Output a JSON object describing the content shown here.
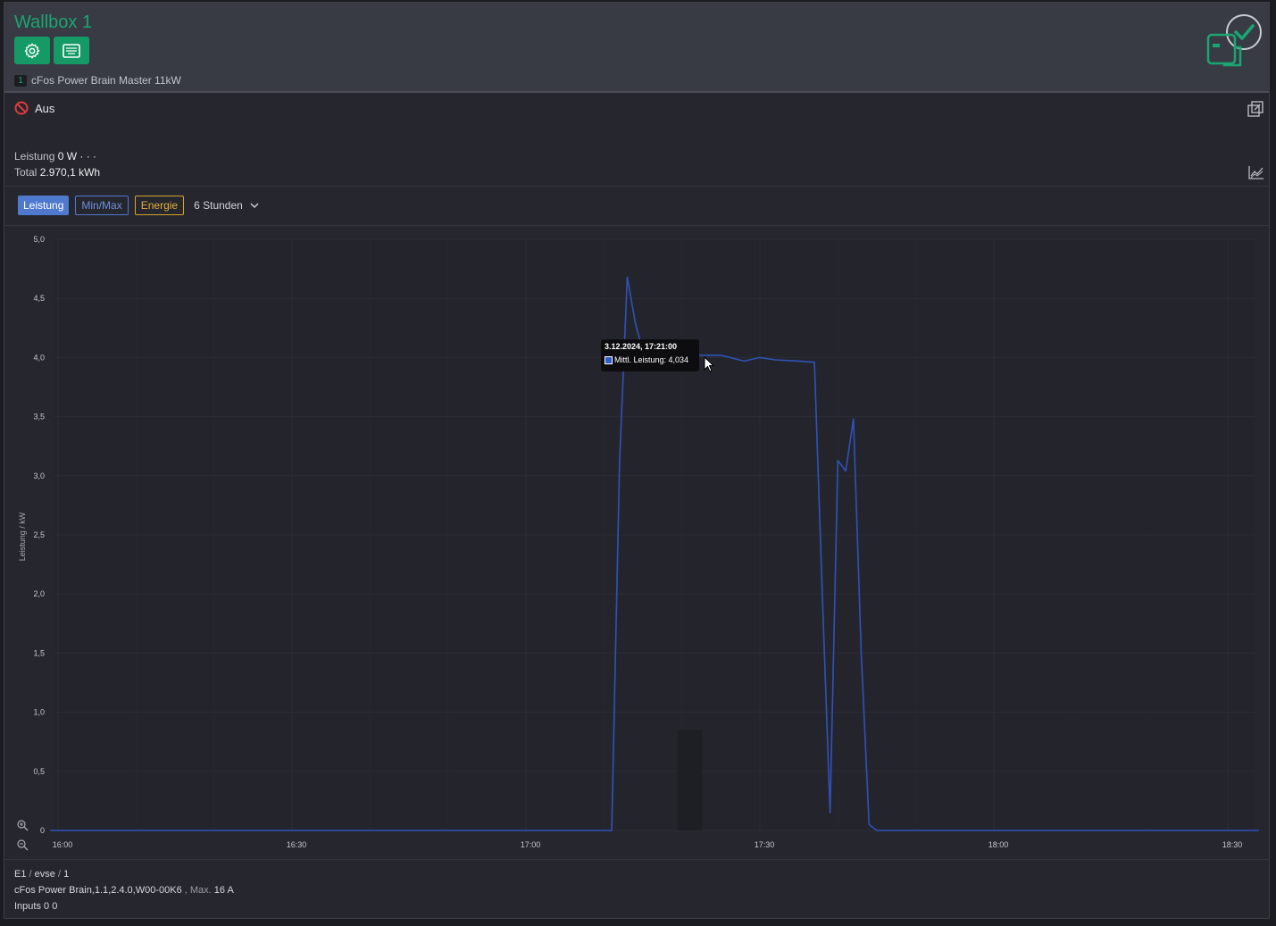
{
  "header": {
    "title": "Wallbox 1",
    "device_number": "1",
    "device_name": "cFos Power Brain Master 11kW"
  },
  "status": {
    "label": "Aus"
  },
  "info": {
    "leistung_label": "Leistung",
    "leistung_value": "0 W · · ·",
    "total_label": "Total",
    "total_value": "2.970,1 kWh"
  },
  "tabs": {
    "leistung": "Leistung",
    "minmax": "Min/Max",
    "energie": "Energie",
    "range": "6 Stunden"
  },
  "tooltip": {
    "date": "3.12.2024, 17:21:00",
    "label": "Mittl. Leistung: 4,034"
  },
  "chart_data": {
    "type": "line",
    "xlabel": "",
    "ylabel": "Leistung / kW",
    "ylim": [
      0,
      5
    ],
    "yticks": [
      "5,0",
      "4,5",
      "4,0",
      "3,5",
      "3,0",
      "2,5",
      "2,0",
      "1,5",
      "1,0",
      "0,5",
      "0"
    ],
    "xticks": [
      "16:00",
      "16:30",
      "17:00",
      "17:30",
      "18:00",
      "18:30"
    ],
    "grid": true,
    "series": [
      {
        "color": "#2f52b8",
        "points": [
          [
            "15:59",
            0
          ],
          [
            "17:11",
            0
          ],
          [
            "17:12",
            3.1
          ],
          [
            "17:13",
            4.68
          ],
          [
            "17:14",
            4.3
          ],
          [
            "17:15",
            4.05
          ],
          [
            "17:20",
            4.04
          ],
          [
            "17:21",
            4.034
          ],
          [
            "17:22",
            4.02
          ],
          [
            "17:25",
            4.02
          ],
          [
            "17:28",
            3.97
          ],
          [
            "17:30",
            4.0
          ],
          [
            "17:32",
            3.98
          ],
          [
            "17:35",
            3.97
          ],
          [
            "17:37",
            3.96
          ],
          [
            "17:38",
            2.0
          ],
          [
            "17:39",
            0.15
          ],
          [
            "17:40",
            3.13
          ],
          [
            "17:41",
            3.04
          ],
          [
            "17:42",
            3.48
          ],
          [
            "17:43",
            1.5
          ],
          [
            "17:44",
            0.05
          ],
          [
            "17:45",
            0.0
          ],
          [
            "18:34",
            0
          ]
        ]
      }
    ]
  },
  "footer": {
    "path_e1": "E1",
    "path_evse": "evse",
    "path_num": "1",
    "slash": "/",
    "device_info": "cFos Power Brain,1.1,2.4.0,W00-00K6",
    "max_label": ", Max.",
    "max_value": "16 A",
    "inputs_label": "Inputs",
    "inputs_value": "0 0"
  }
}
